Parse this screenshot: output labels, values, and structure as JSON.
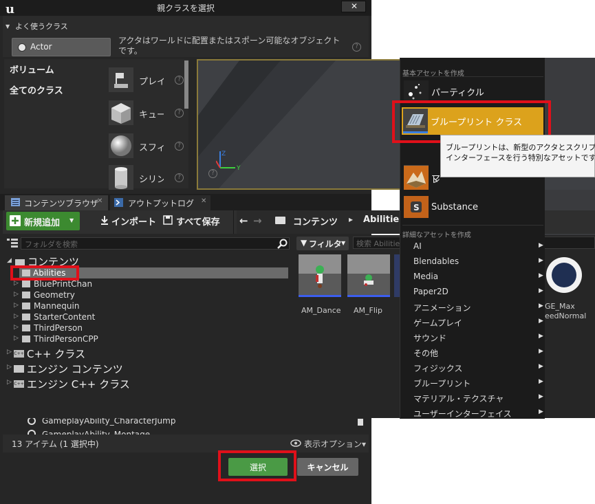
{
  "dialog": {
    "title": "親クラスを選択",
    "close_symbol": "✕",
    "favorites_header": "よく使うクラス",
    "actor_label": "Actor",
    "actor_description": "アクタはワールドに配置またはスポーン可能なオブジェクトです。",
    "help_symbol": "?",
    "categories": [
      "ボリューム",
      "全てのクラス"
    ],
    "assets": [
      {
        "label": "プレイ",
        "icon": "player-start-icon"
      },
      {
        "label": "キュー",
        "icon": "cube-icon"
      },
      {
        "label": "スフィ",
        "icon": "sphere-icon"
      },
      {
        "label": "シリン",
        "icon": "cylinder-icon"
      }
    ],
    "class_list": [
      "GameplayAbility_CharacterJump",
      "GameplayAbility_Montage"
    ],
    "status": "13 アイテム (1 選択中)",
    "view_options": "表示オプション▾",
    "select_label": "選択",
    "cancel_label": "キャンセル"
  },
  "browser": {
    "tabs": [
      "コンテンツブラウザ",
      "アウトプットログ"
    ],
    "new_label": "新規追加",
    "import_label": "インポート",
    "save_all_label": "すべて保存",
    "path": [
      "コンテンツ",
      "Abilities"
    ],
    "folder_search_placeholder": "フォルダを検索",
    "filter_label": "フィルタ",
    "asset_search_placeholder": "検索 Abilities",
    "tree": {
      "root": "コンテンツ",
      "children": [
        "Abilities",
        "BluePrintChan",
        "Geometry",
        "Mannequin",
        "StarterContent",
        "ThirdPerson",
        "ThirdPersonCPP"
      ],
      "others": [
        "C++ クラス",
        "エンジン コンテンツ",
        "エンジン C++ クラス"
      ]
    },
    "asset_tiles": [
      "AM_Dance",
      "AM_Flip",
      "GE_Max",
      "eedNormal"
    ]
  },
  "context_menu": {
    "basic_header": "基本アセットを作成",
    "basic_items": [
      "パーティクル",
      "ブループリント クラス",
      "マ",
      "レ",
      "Substance"
    ],
    "advanced_header": "詳細なアセットを作成",
    "advanced_items": [
      "AI",
      "Blendables",
      "Media",
      "Paper2D",
      "アニメーション",
      "ゲームプレイ",
      "サウンド",
      "その他",
      "フィジックス",
      "ブループリント",
      "マテリアル・テクスチャ",
      "ユーザーインターフェイス"
    ],
    "tooltip_lines": [
      "ブループリントは、新型のアクタとスクリプ",
      "インターフェースを行う特別なアセットです"
    ]
  },
  "colors": {
    "highlight": "#dca21c",
    "red_frame": "#e0101a",
    "green_button": "#4a9a45"
  }
}
